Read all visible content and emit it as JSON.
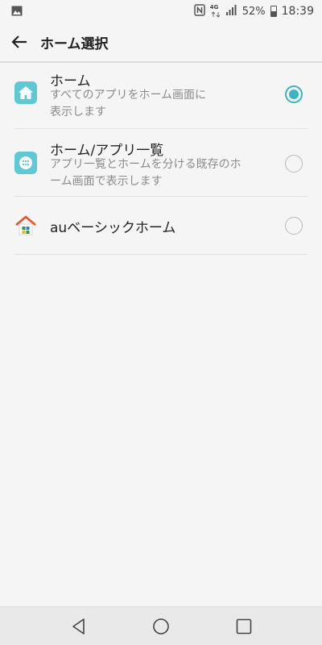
{
  "status_bar": {
    "network_label": "4G",
    "battery_percent": "52%",
    "time": "18:39"
  },
  "header": {
    "title": "ホーム選択"
  },
  "options": [
    {
      "title": "ホーム",
      "subtitle_line1": "すべてのアプリをホーム画面に",
      "subtitle_line2": "表示します",
      "selected": true,
      "icon": "house-icon"
    },
    {
      "title": "ホーム/アプリ一覧",
      "subtitle_line1": "アプリ一覧とホームを分ける既存のホ",
      "subtitle_line2": "ーム画面で表示します",
      "selected": false,
      "icon": "app-drawer-icon"
    },
    {
      "title": "auベーシックホーム",
      "selected": false,
      "icon": "au-basic-home-icon"
    }
  ],
  "colors": {
    "accent": "#3bb3c3",
    "icon_bg": "#5ec8d4"
  },
  "nav_bar": {
    "back": "back-icon",
    "home": "home-icon",
    "recents": "recents-icon"
  }
}
